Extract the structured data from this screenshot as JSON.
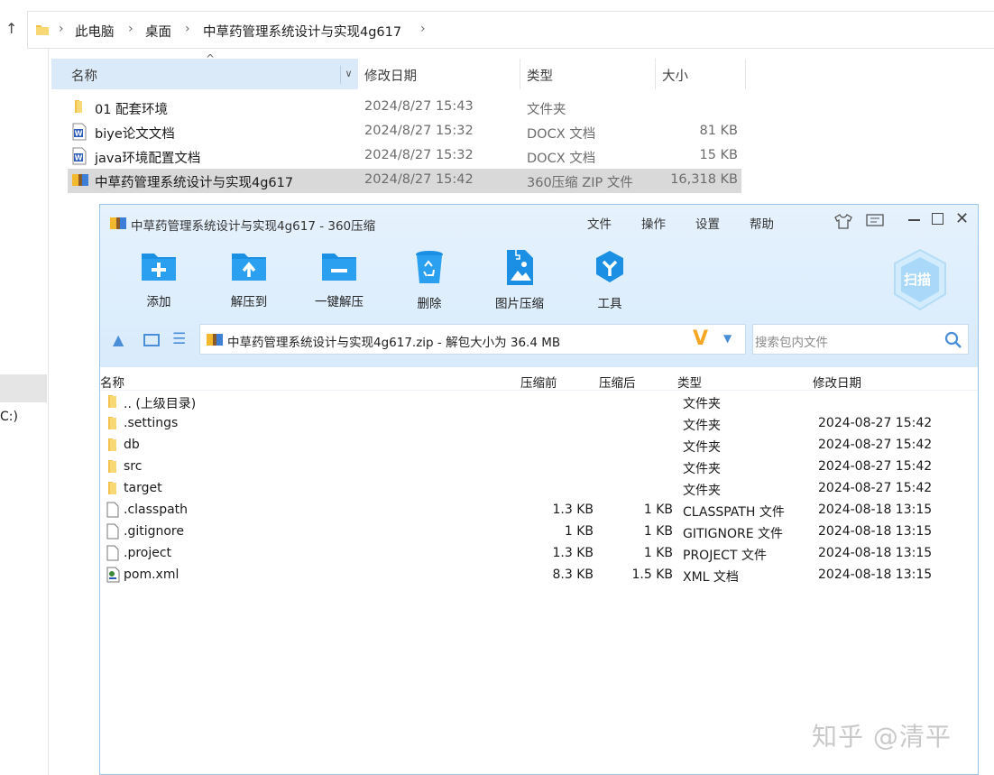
{
  "explorer": {
    "breadcrumb": [
      "此电脑",
      "桌面",
      "中草药管理系统设计与实现4g617"
    ],
    "left_nav_label": "C:)",
    "columns": {
      "name": "名称",
      "date": "修改日期",
      "type": "类型",
      "size": "大小"
    },
    "files": [
      {
        "name": "01 配套环境",
        "date": "2024/8/27 15:43",
        "type": "文件夹",
        "size": "",
        "icon": "folder-icon"
      },
      {
        "name": "biye论文文档",
        "date": "2024/8/27 15:32",
        "type": "DOCX 文档",
        "size": "81 KB",
        "icon": "word-doc-icon"
      },
      {
        "name": "java环境配置文档",
        "date": "2024/8/27 15:32",
        "type": "DOCX 文档",
        "size": "15 KB",
        "icon": "word-doc-icon"
      },
      {
        "name": "中草药管理系统设计与实现4g617",
        "date": "2024/8/27 15:42",
        "type": "360压缩 ZIP 文件",
        "size": "16,318 KB",
        "icon": "zip-icon",
        "selected": true
      }
    ]
  },
  "archive_window": {
    "title": "中草药管理系统设计与实现4g617 - 360压缩",
    "menu": [
      "文件",
      "操作",
      "设置",
      "帮助"
    ],
    "toolbar": [
      {
        "label": "添加",
        "icon": "add-folder-icon"
      },
      {
        "label": "解压到",
        "icon": "extract-to-icon"
      },
      {
        "label": "一键解压",
        "icon": "one-click-extract-icon"
      },
      {
        "label": "删除",
        "icon": "recycle-bin-icon"
      },
      {
        "label": "图片压缩",
        "icon": "image-compress-icon"
      },
      {
        "label": "工具",
        "icon": "tools-icon"
      }
    ],
    "scan_label": "扫描",
    "path_text": "中草药管理系统设计与实现4g617.zip - 解包大小为 36.4 MB",
    "search_placeholder": "搜索包内文件",
    "columns": {
      "name": "名称",
      "before": "压缩前",
      "after": "压缩后",
      "type": "类型",
      "date": "修改日期"
    },
    "entries": [
      {
        "name": ".. (上级目录)",
        "before": "",
        "after": "",
        "type": "文件夹",
        "date": "",
        "icon": "folder-icon"
      },
      {
        "name": ".settings",
        "before": "",
        "after": "",
        "type": "文件夹",
        "date": "2024-08-27 15:42",
        "icon": "folder-icon"
      },
      {
        "name": "db",
        "before": "",
        "after": "",
        "type": "文件夹",
        "date": "2024-08-27 15:42",
        "icon": "folder-icon"
      },
      {
        "name": "src",
        "before": "",
        "after": "",
        "type": "文件夹",
        "date": "2024-08-27 15:42",
        "icon": "folder-icon"
      },
      {
        "name": "target",
        "before": "",
        "after": "",
        "type": "文件夹",
        "date": "2024-08-27 15:42",
        "icon": "folder-icon"
      },
      {
        "name": ".classpath",
        "before": "1.3 KB",
        "after": "1 KB",
        "type": "CLASSPATH 文件",
        "date": "2024-08-18 13:15",
        "icon": "file-icon"
      },
      {
        "name": ".gitignore",
        "before": "1 KB",
        "after": "1 KB",
        "type": "GITIGNORE 文件",
        "date": "2024-08-18 13:15",
        "icon": "file-icon"
      },
      {
        "name": ".project",
        "before": "1.3 KB",
        "after": "1 KB",
        "type": "PROJECT 文件",
        "date": "2024-08-18 13:15",
        "icon": "file-icon"
      },
      {
        "name": "pom.xml",
        "before": "8.3 KB",
        "after": "1.5 KB",
        "type": "XML 文档",
        "date": "2024-08-18 13:15",
        "icon": "xml-file-icon"
      }
    ]
  },
  "watermark": "知乎 @清平",
  "colors": {
    "accent": "#1a8fe3",
    "toolbar_bg": "#e1effd",
    "selected_row": "#d9d9d9",
    "folder": "#f3c14a"
  }
}
